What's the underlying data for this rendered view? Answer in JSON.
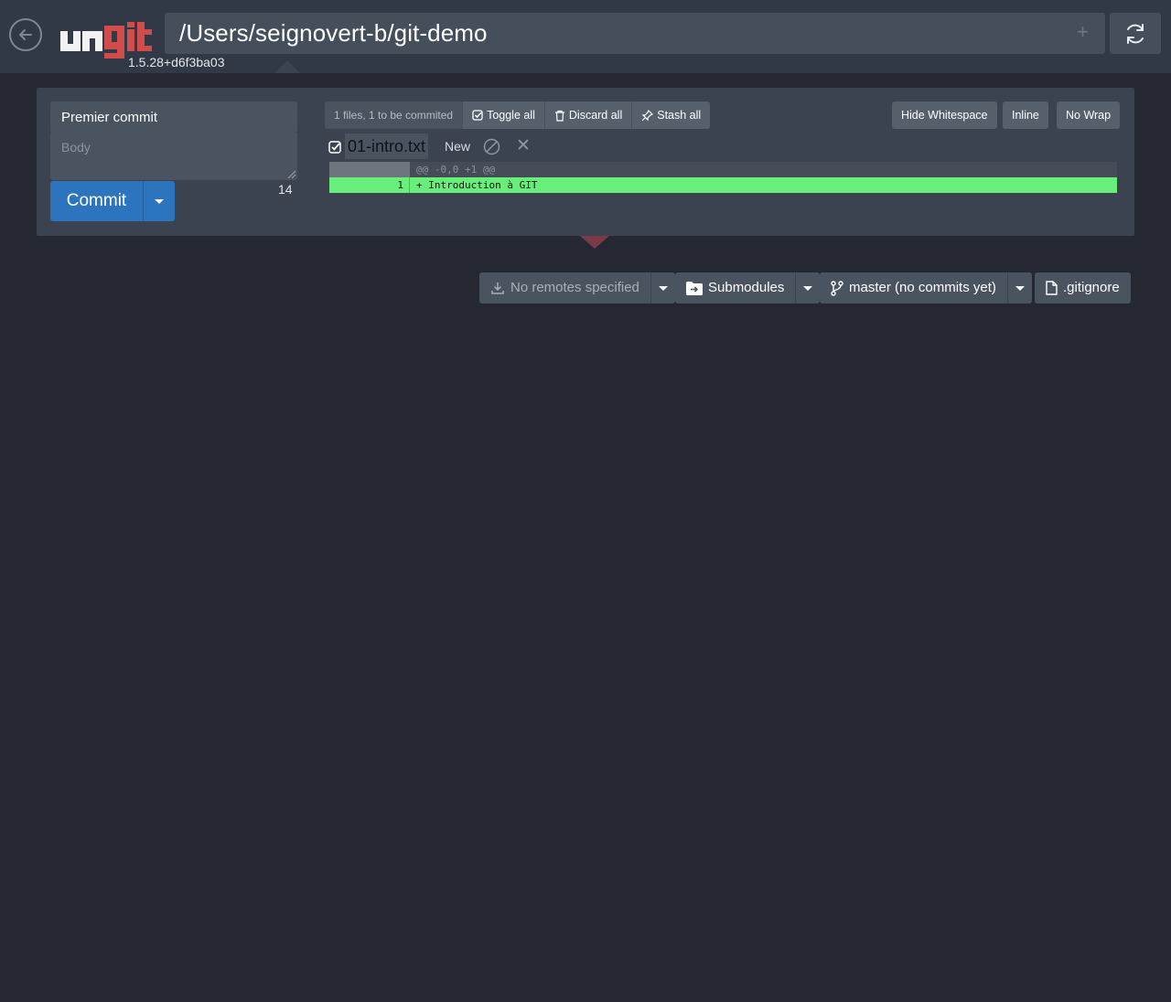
{
  "header": {
    "version": "1.5.28+d6f3ba03",
    "repo_path": "/Users/seignovert-b/git-demo",
    "add_symbol": "+",
    "logo_alt": "ungit"
  },
  "staging": {
    "commit_title": "Premier commit",
    "body_placeholder": "Body",
    "char_count": "14",
    "commit_label": "Commit",
    "files_summary": "1 files, 1 to be commited",
    "toggle_all": "Toggle all",
    "discard_all": "Discard all",
    "stash_all": "Stash all",
    "hide_whitespace": "Hide Whitespace",
    "inline": "Inline",
    "no_wrap": "No Wrap"
  },
  "files": [
    {
      "name": "01-intro.txt",
      "status": "New",
      "staged": true,
      "diff": [
        {
          "type": "hunk",
          "line_no": "",
          "text": "@@ -0,0 +1 @@"
        },
        {
          "type": "add",
          "line_no": "1",
          "text": "+ Introduction à GIT"
        }
      ]
    }
  ],
  "toolbar": {
    "remotes": "No remotes specified",
    "submodules": "Submodules",
    "branch": "master (no commits yet)",
    "gitignore": ".gitignore"
  },
  "colors": {
    "background": "#252833",
    "topbar": "#313946",
    "panel": "#3b4350",
    "commit_blue": "#2d74be",
    "diff_added": "#68ef7a",
    "logo_red": "#d24c4c"
  }
}
